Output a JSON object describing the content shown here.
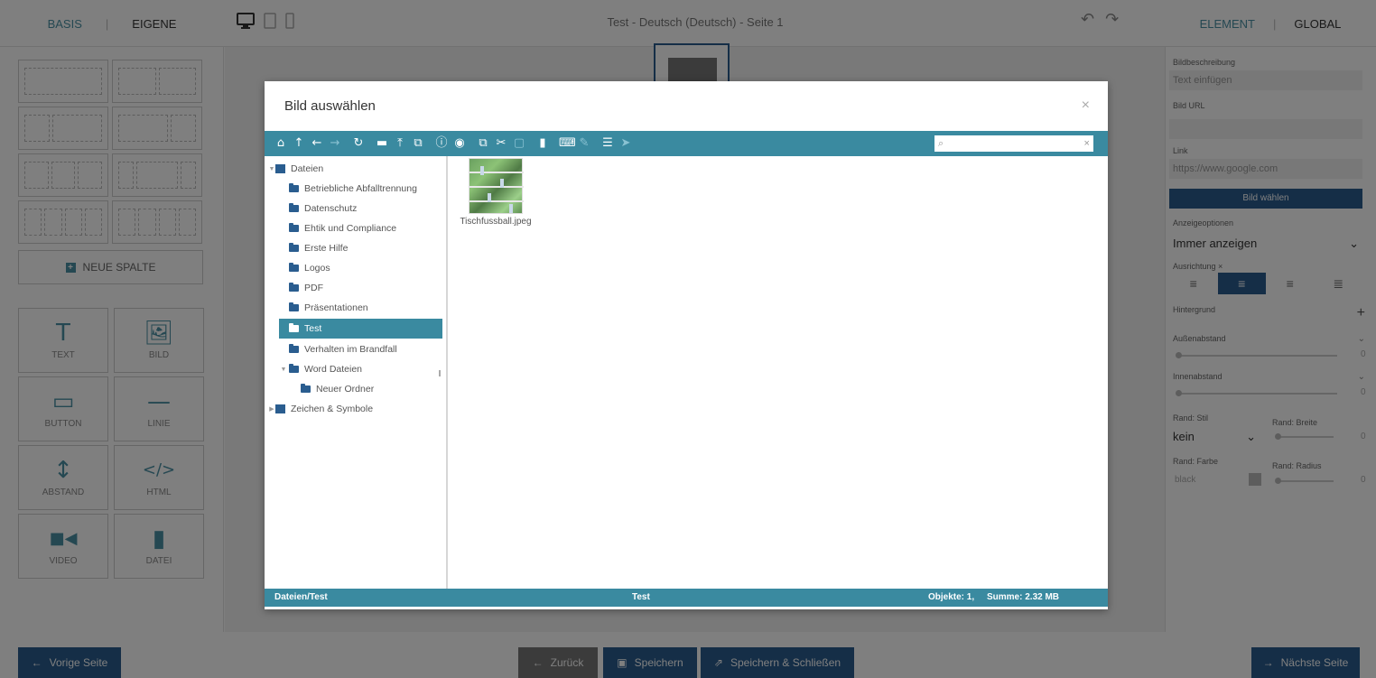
{
  "editor": {
    "left_tabs": {
      "basis": "BASIS",
      "eigene": "EIGENE",
      "separator": "|"
    },
    "device_icons": [
      "desktop-icon",
      "tablet-icon",
      "mobile-icon"
    ],
    "page_title": "Test - Deutsch (Deutsch) - Seite 1",
    "right_tabs": {
      "element": "ELEMENT",
      "global": "GLOBAL",
      "separator": "|"
    },
    "new_column_label": "NEUE SPALTE",
    "widgets": [
      {
        "icon": "text-icon",
        "glyph": "T",
        "label": "TEXT"
      },
      {
        "icon": "image-icon",
        "glyph": "🖼",
        "label": "BILD"
      },
      {
        "icon": "button-icon",
        "glyph": "▭",
        "label": "BUTTON"
      },
      {
        "icon": "line-icon",
        "glyph": "—",
        "label": "LINIE"
      },
      {
        "icon": "spacing-icon",
        "glyph": "↕",
        "label": "ABSTAND"
      },
      {
        "icon": "code-icon",
        "glyph": "</>",
        "label": "HTML"
      },
      {
        "icon": "video-icon",
        "glyph": "■◀",
        "label": "VIDEO"
      },
      {
        "icon": "file-icon",
        "glyph": "▮",
        "label": "DATEI"
      }
    ]
  },
  "properties": {
    "image_description_label": "Bildbeschreibung",
    "image_description_placeholder": "Text einfügen",
    "image_url_label": "Bild URL",
    "link_label": "Link",
    "link_placeholder": "https://www.google.com",
    "choose_image_button": "Bild wählen",
    "display_options_label": "Anzeigeoptionen",
    "display_option_value": "Immer anzeigen",
    "alignment_label": "Ausrichtung ×",
    "background_label": "Hintergrund",
    "margin_label": "Außenabstand",
    "margin_value": "0",
    "padding_label": "Innenabstand",
    "padding_value": "0",
    "border_style_label": "Rand: Stil",
    "border_style_value": "kein",
    "border_width_label": "Rand: Breite",
    "border_width_value": "0",
    "border_color_label": "Rand: Farbe",
    "border_color_value": "black",
    "border_radius_label": "Rand: Radius",
    "border_radius_value": "0"
  },
  "bottom": {
    "prev_page": "Vorige Seite",
    "back": "Zurück",
    "save": "Speichern",
    "save_close": "Speichern & Schließen",
    "next_page": "Nächste Seite"
  },
  "modal": {
    "title": "Bild auswählen",
    "close": "×",
    "search_placeholder": "",
    "tree": [
      {
        "label": "Dateien",
        "level": 0,
        "type": "root",
        "expanded": true
      },
      {
        "label": "Betriebliche Abfalltrennung",
        "level": 1
      },
      {
        "label": "Datenschutz",
        "level": 1
      },
      {
        "label": "Ehtik und Compliance",
        "level": 1
      },
      {
        "label": "Erste Hilfe",
        "level": 1
      },
      {
        "label": "Logos",
        "level": 1
      },
      {
        "label": "PDF",
        "level": 1
      },
      {
        "label": "Präsentationen",
        "level": 1
      },
      {
        "label": "Test",
        "level": 1,
        "selected": true
      },
      {
        "label": "Verhalten im Brandfall",
        "level": 1
      },
      {
        "label": "Word Dateien",
        "level": 1,
        "expanded": true
      },
      {
        "label": "Neuer Ordner",
        "level": 2
      },
      {
        "label": "Zeichen & Symbole",
        "level": 0,
        "type": "root",
        "expanded": false
      }
    ],
    "files": [
      {
        "name": "Tischfussball.jpeg",
        "icon": "image-thumbnail"
      }
    ],
    "status": {
      "path": "Dateien/Test",
      "cwd": "Test",
      "count": "Objekte: 1,",
      "size": "Summe: 2.32 MB"
    }
  },
  "colors": {
    "accent": "#3a8aa0",
    "dark_blue": "#2a5d8f",
    "overlay": "rgba(0,0,0,0.5)"
  }
}
